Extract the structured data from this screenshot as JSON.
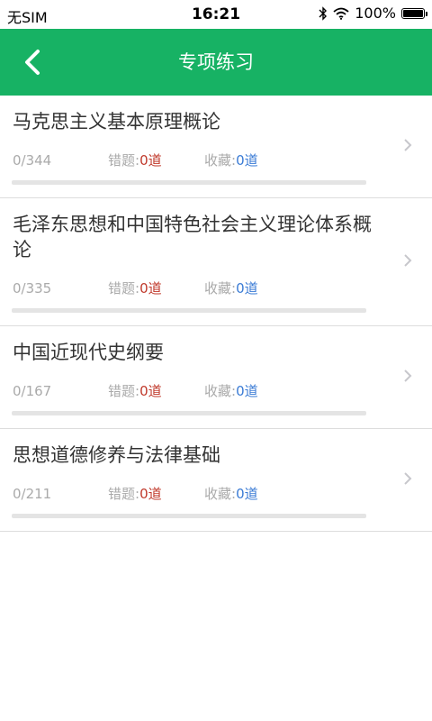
{
  "status_bar": {
    "carrier": "无SIM",
    "time": "16:21",
    "battery_text": "100%",
    "battery_level": 1.0
  },
  "nav": {
    "title": "专项练习",
    "back_icon": "chevron-left-icon"
  },
  "labels": {
    "wrong": "错题:",
    "favorite": "收藏:"
  },
  "subjects": [
    {
      "name": "马克思主义基本原理概论",
      "progress_text": "0/344",
      "progress": 0,
      "wrong": "0道",
      "favorite": "0道"
    },
    {
      "name": "毛泽东思想和中国特色社会主义理论体系概论",
      "progress_text": "0/335",
      "progress": 0,
      "wrong": "0道",
      "favorite": "0道"
    },
    {
      "name": "中国近现代史纲要",
      "progress_text": "0/167",
      "progress": 0,
      "wrong": "0道",
      "favorite": "0道"
    },
    {
      "name": "思想道德修养与法律基础",
      "progress_text": "0/211",
      "progress": 0,
      "wrong": "0道",
      "favorite": "0道"
    }
  ],
  "colors": {
    "accent": "#17b264",
    "wrong": "#c0392b",
    "favorite": "#3a7bd5"
  }
}
